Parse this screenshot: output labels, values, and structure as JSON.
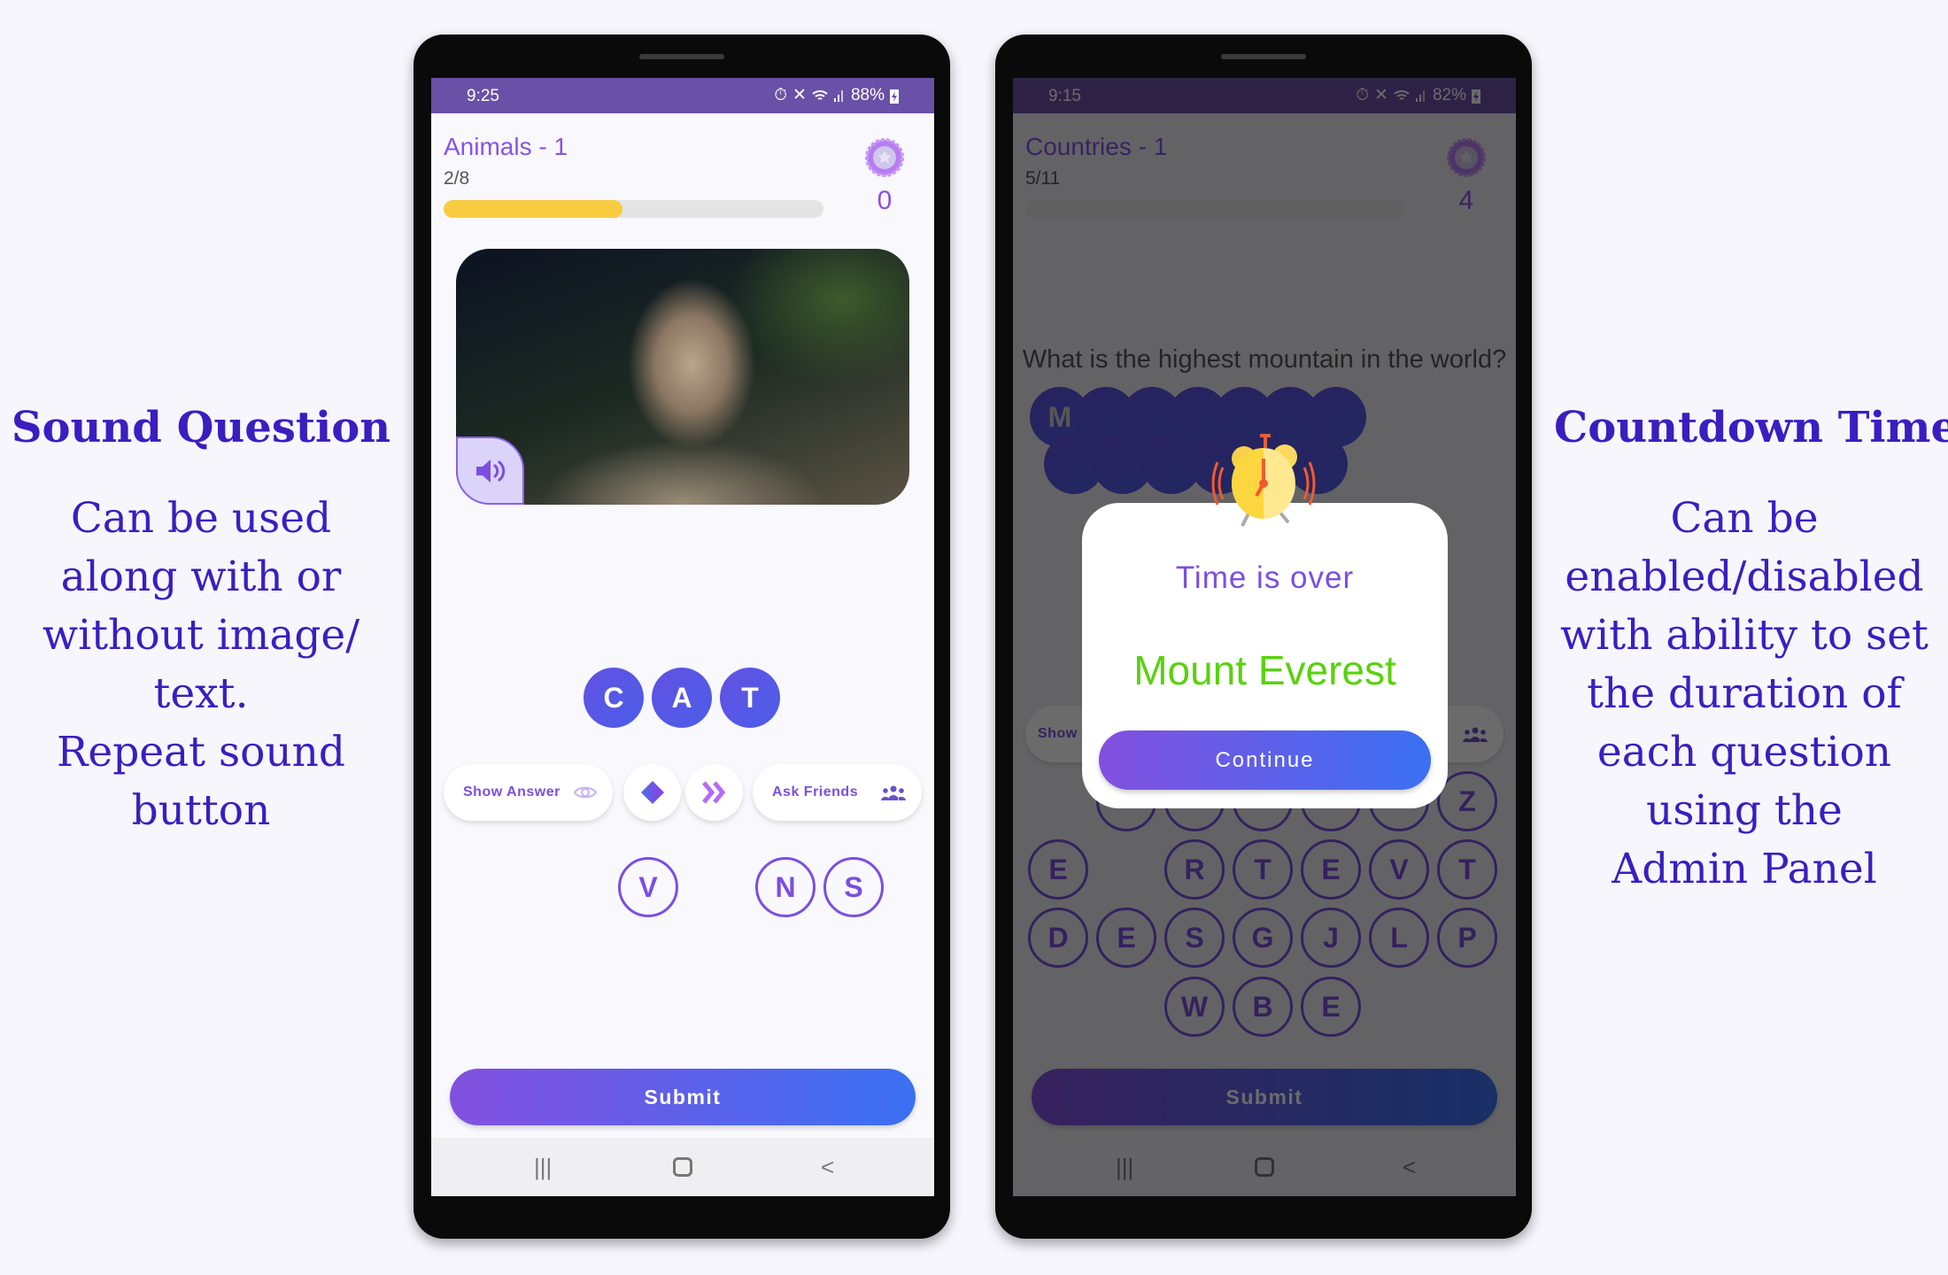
{
  "left_caption": {
    "heading": "Sound Question",
    "lines": [
      "Can be used",
      "along with or",
      "without image/",
      "text.",
      "Repeat sound",
      "button"
    ]
  },
  "right_caption": {
    "heading": "Countdown Timer",
    "lines": [
      "Can be",
      "enabled/disabled",
      "with ability to set",
      "the duration of",
      "each question",
      "using the",
      "Admin Panel"
    ]
  },
  "colors": {
    "accent": "#7b4fe0",
    "progress": "#f9cb41",
    "correct": "#5ad10f",
    "status_bar": "#6a50a7"
  },
  "phone1": {
    "status": {
      "time": "9:25",
      "battery": "88%"
    },
    "title": "Animals - 1",
    "count": "2/8",
    "progress": 0.47,
    "score": "0",
    "answer": [
      "C",
      "A",
      "T"
    ],
    "buttons": {
      "show_answer": "Show Answer",
      "ask_friends": "Ask Friends",
      "sound": "speaker-icon",
      "hint": "diamond-icon",
      "skip": "double-chevron-icon"
    },
    "letters": [
      "V",
      "N",
      "S"
    ],
    "submit": "Submit"
  },
  "phone2": {
    "status": {
      "time": "9:15",
      "battery": "82%"
    },
    "title": "Countries - 1",
    "count": "5/11",
    "progress": 0,
    "score": "4",
    "question": "What is the highest mountain in the world?",
    "answer_first": "M",
    "buttons": {
      "show_answer": "Show",
      "ask_friends": "s"
    },
    "keyboard": [
      [
        "",
        "",
        "",
        "",
        "",
        "",
        "Z"
      ],
      [
        "E",
        "",
        "R",
        "T",
        "E",
        "V",
        "T"
      ],
      [
        "D",
        "E",
        "S",
        "G",
        "J",
        "L",
        "P"
      ],
      [
        "",
        "",
        "W",
        "B",
        "E",
        "",
        ""
      ]
    ],
    "dialog": {
      "title": "Time is over",
      "answer": "Mount Everest",
      "button": "Continue"
    },
    "submit": "Submit"
  }
}
